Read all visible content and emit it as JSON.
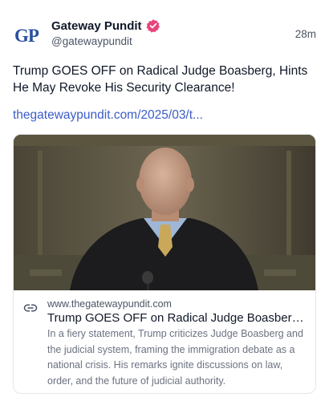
{
  "post": {
    "author": {
      "avatar_text": "GP",
      "display_name": "Gateway Pundit",
      "handle": "@gatewaypundit",
      "verified_icon": "verified-badge-icon"
    },
    "time": "28m",
    "text": "Trump GOES OFF on Radical Judge Boasberg, Hints He May Revoke His Security Clearance!",
    "link_text": "thegatewaypundit.com/2025/03/t..."
  },
  "card": {
    "icon": "link-icon",
    "domain": "www.thegatewaypundit.com",
    "title": "Trump GOES OFF on Radical Judge Boasberg, ...",
    "description": "In a fiery statement, Trump criticizes Judge Boasberg and the judicial system, framing the immigration debate as a national crisis. His remarks ignite discussions on law, order, and the future of judicial authority."
  },
  "colors": {
    "brand_blue": "#2a4fa0",
    "verified_pink": "#e8447a",
    "link": "#3b5cc8"
  }
}
